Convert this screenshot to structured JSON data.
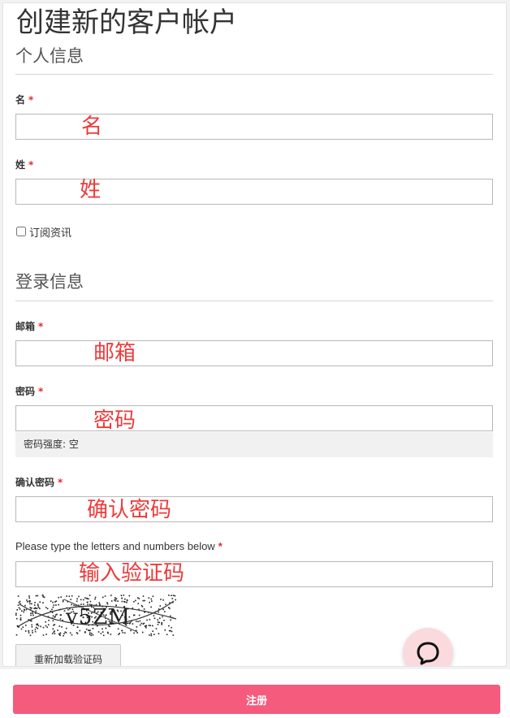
{
  "page": {
    "title": "创建新的客户帐户"
  },
  "personal": {
    "section_title": "个人信息",
    "first_name": {
      "label": "名",
      "required_mark": "*",
      "value": "",
      "overlay": "名"
    },
    "last_name": {
      "label": "姓",
      "required_mark": "*",
      "value": "",
      "overlay": "姓"
    },
    "newsletter": {
      "label": "订阅资讯",
      "checked": false
    }
  },
  "login": {
    "section_title": "登录信息",
    "email": {
      "label": "邮箱",
      "required_mark": "*",
      "value": "",
      "overlay": "邮箱"
    },
    "password": {
      "label": "密码",
      "required_mark": "*",
      "value": "",
      "overlay": "密码",
      "strength_text": "密码强度: 空"
    },
    "confirm_password": {
      "label": "确认密码",
      "required_mark": "*",
      "value": "",
      "overlay": "确认密码"
    },
    "captcha": {
      "label": "Please type the letters and numbers below",
      "required_mark": "*",
      "value": "",
      "overlay": "输入验证码",
      "image_text": "v5ZM",
      "reload_label": "重新加载验证码"
    }
  },
  "actions": {
    "submit_label": "注册"
  },
  "icons": {
    "chat": "chat-bubble-icon"
  },
  "colors": {
    "accent": "#f45b7c",
    "required": "#e02b2b",
    "overlay_text": "#ee3a3a",
    "chat_bg": "#fadadd"
  }
}
